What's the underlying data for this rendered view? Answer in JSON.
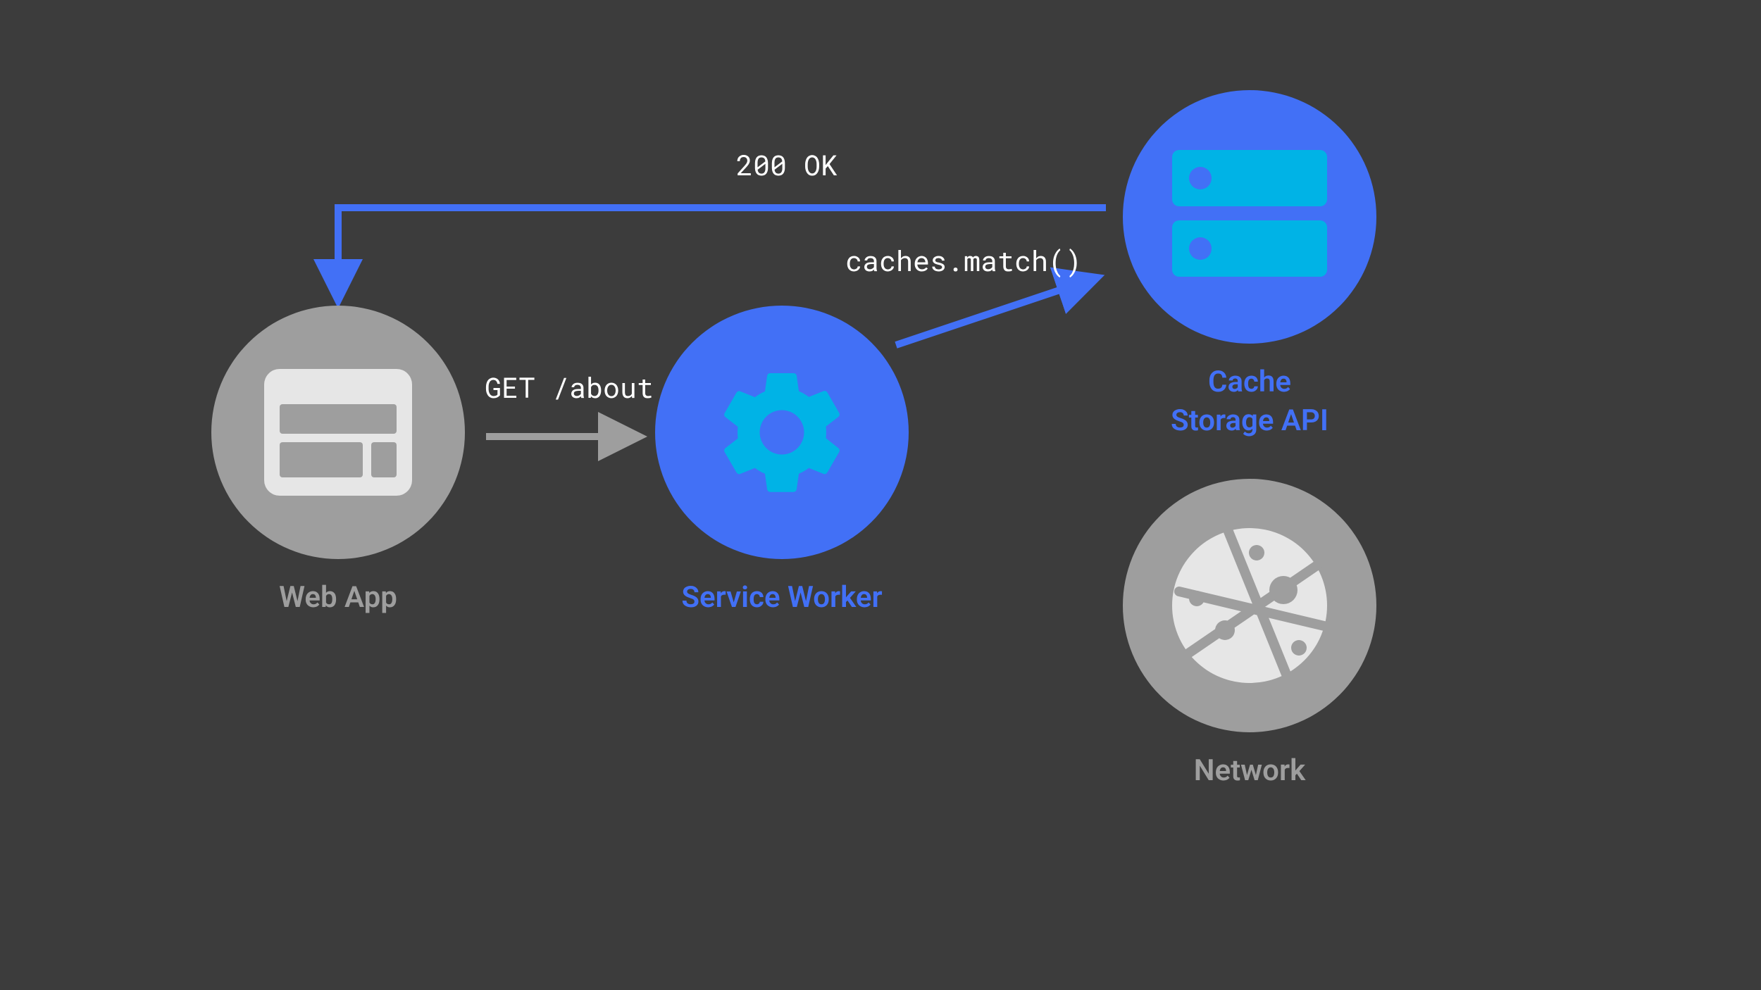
{
  "colors": {
    "bg": "#3c3c3c",
    "gray": "#9e9e9e",
    "grayLight": "#e6e6e6",
    "blue": "#4270f6",
    "cyan": "#00b3e6",
    "white": "#ffffff"
  },
  "nodes": {
    "webApp": {
      "label": "Web App"
    },
    "serviceWorker": {
      "label": "Service Worker"
    },
    "cacheStorage": {
      "label": "Cache\nStorage API"
    },
    "network": {
      "label": "Network"
    }
  },
  "edges": {
    "getAbout": {
      "label": "GET /about"
    },
    "cachesMatch": {
      "label": "caches.match()"
    },
    "ok200": {
      "label": "200 OK"
    }
  }
}
